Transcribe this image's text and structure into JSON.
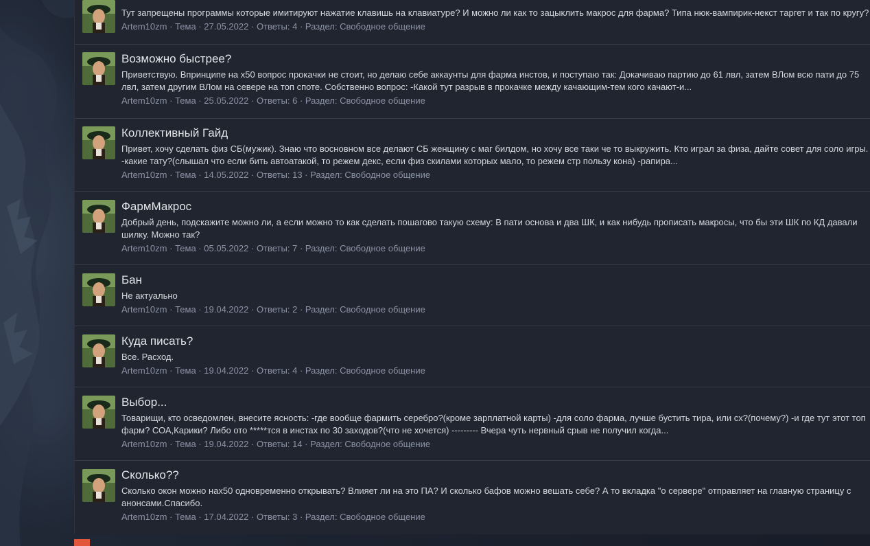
{
  "sep": "·",
  "results": [
    {
      "title": "",
      "snippet": "Тут запрещены программы которые имитируют нажатие клавишь на клавиатуре? И можно ли как то зацыклить макрос для фарма? Типа нюк-вампирик-некст таргет и так по кругу?",
      "author": "Artem10zm",
      "type": "Тема",
      "date": "27.05.2022",
      "replies": "Ответы: 4",
      "section": "Раздел: Свободное общение"
    },
    {
      "title": "Возможно быстрее?",
      "snippet": "Приветствую. Впринципе на х50 вопрос прокачки не стоит, но делаю себе аккаунты для фарма инстов, и поступаю так: Докачиваю партию до 61 лвл, затем ВЛом всю пати до 75 лвл, затем другим ВЛом на севере на топ споте. Собственно вопрос: -Какой тут разрыв в прокачке между качающим-тем кого качают-и...",
      "author": "Artem10zm",
      "type": "Тема",
      "date": "25.05.2022",
      "replies": "Ответы: 6",
      "section": "Раздел: Свободное общение"
    },
    {
      "title": "Коллективный Гайд",
      "snippet": "Привет, хочу сделать физ СБ(мужик). Знаю что восновном все делают СБ женщину с маг билдом, но хочу все таки че то выкружить. Кто играл за физа, дайте совет для соло игры. -какие тату?(слышал что если бить автоатакой, то режем декс, если физ скилами которых мало, то режем стр пользу кона) -рапира...",
      "author": "Artem10zm",
      "type": "Тема",
      "date": "14.05.2022",
      "replies": "Ответы: 13",
      "section": "Раздел: Свободное общение"
    },
    {
      "title": "ФармМакрос",
      "snippet": "Добрый день, подскажите можно ли, а если можно то как сделать пошагово такую схему: В пати основа и два ШК, и как нибудь прописать макросы, что бы эти ШК по КД давали шилку. Можно так?",
      "author": "Artem10zm",
      "type": "Тема",
      "date": "05.05.2022",
      "replies": "Ответы: 7",
      "section": "Раздел: Свободное общение"
    },
    {
      "title": "Бан",
      "snippet": "Не актуально",
      "author": "Artem10zm",
      "type": "Тема",
      "date": "19.04.2022",
      "replies": "Ответы: 2",
      "section": "Раздел: Свободное общение"
    },
    {
      "title": "Куда писать?",
      "snippet": "Все. Расход.",
      "author": "Artem10zm",
      "type": "Тема",
      "date": "19.04.2022",
      "replies": "Ответы: 4",
      "section": "Раздел: Свободное общение"
    },
    {
      "title": "Выбор...",
      "snippet": "Товарищи, кто осведомлен, внесите ясность: -где вообще фармить серебро?(кроме зарплатной карты) -для соло фарма, лучше бустить тира, или сх?(почему?) -и где тут этот топ фарм? СОА,Карики? Либо ото *****тся в инстах по 30 заходов?(что не хочется) --------- Вчера чуть нервный срыв не получил когда...",
      "author": "Artem10zm",
      "type": "Тема",
      "date": "19.04.2022",
      "replies": "Ответы: 14",
      "section": "Раздел: Свободное общение"
    },
    {
      "title": "Сколько??",
      "snippet": "Сколько окон можно нах50 одновременно открывать? Влияет ли на это ПА? И сколько бафов можно вешать себе? А то вкладка \"о сервере\" отправляет на главную страницу с анонсами.Спасибо.",
      "author": "Artem10zm",
      "type": "Тема",
      "date": "17.04.2022",
      "replies": "Ответы: 3",
      "section": "Раздел: Свободное общение"
    }
  ]
}
